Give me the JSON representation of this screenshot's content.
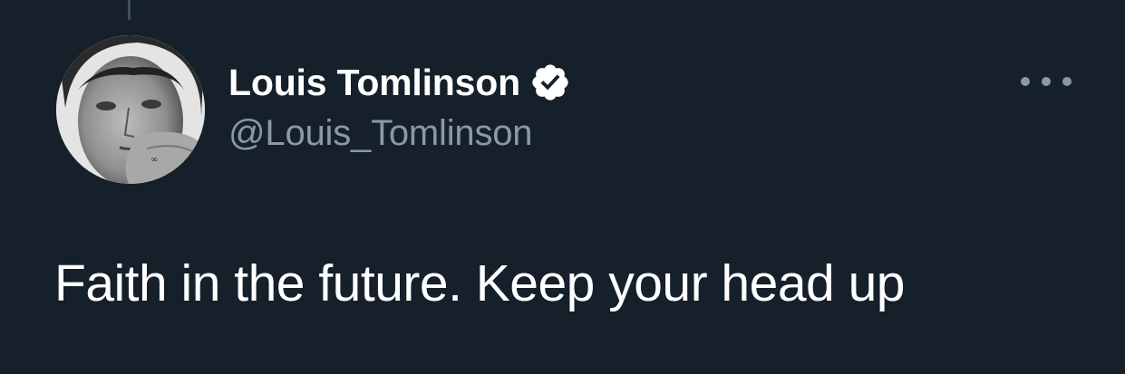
{
  "tweet": {
    "author": {
      "display_name": "Louis Tomlinson",
      "handle": "@Louis_Tomlinson",
      "verified": true,
      "avatar_icon": "profile-photo"
    },
    "text": "Faith in the future. Keep your head up",
    "more_icon": "more-horizontal-icon"
  },
  "colors": {
    "background": "#15202b",
    "text_primary": "#ffffff",
    "text_secondary": "#8b98a5",
    "thread_line": "#3d4f60"
  }
}
